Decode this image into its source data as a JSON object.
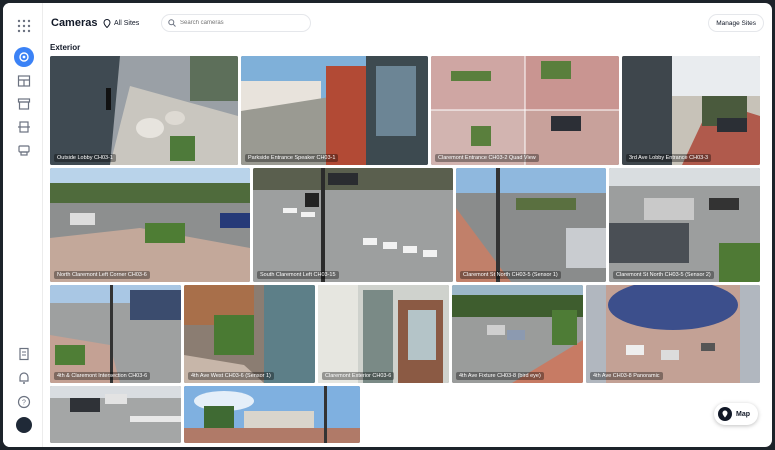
{
  "app": {
    "title": "Cameras",
    "site_selector": "All Sites",
    "search_placeholder": "Search cameras",
    "manage_sites_label": "Manage Sites",
    "section_title": "Exterior",
    "map_button_label": "Map"
  },
  "sidebar": {
    "icons": [
      "grid-menu-icon",
      "cameras-icon",
      "dashboard-icon",
      "archive-icon",
      "access-control-icon",
      "device-icon",
      "document-icon",
      "bell-icon",
      "help-icon",
      "avatar"
    ]
  },
  "cameras": [
    {
      "label": "Outside Lobby CH03-1"
    },
    {
      "label": "Parkside Entrance Speaker CH03-1"
    },
    {
      "label": "Claremont Entrance CH03-2 Quad View"
    },
    {
      "label": "3rd Ave Lobby Entrance CH03-3"
    },
    {
      "label": "North Claremont Left Corner CH03-6"
    },
    {
      "label": "South Claremont Left CH03-15"
    },
    {
      "label": "Claremont St North CH03-5 (Sensor 1)"
    },
    {
      "label": "Claremont St North CH03-5 (Sensor 2)"
    },
    {
      "label": "4th & Claremont Intersection CH03-6"
    },
    {
      "label": "4th Ave West CH03-6 (Sensor 1)"
    },
    {
      "label": "Claremont Exterior CH03-6"
    },
    {
      "label": "4th Ave Fixture CH03-8 (bird eye)"
    },
    {
      "label": "4th Ave CH03-8 Panoramic"
    },
    {
      "label": ""
    },
    {
      "label": ""
    }
  ]
}
